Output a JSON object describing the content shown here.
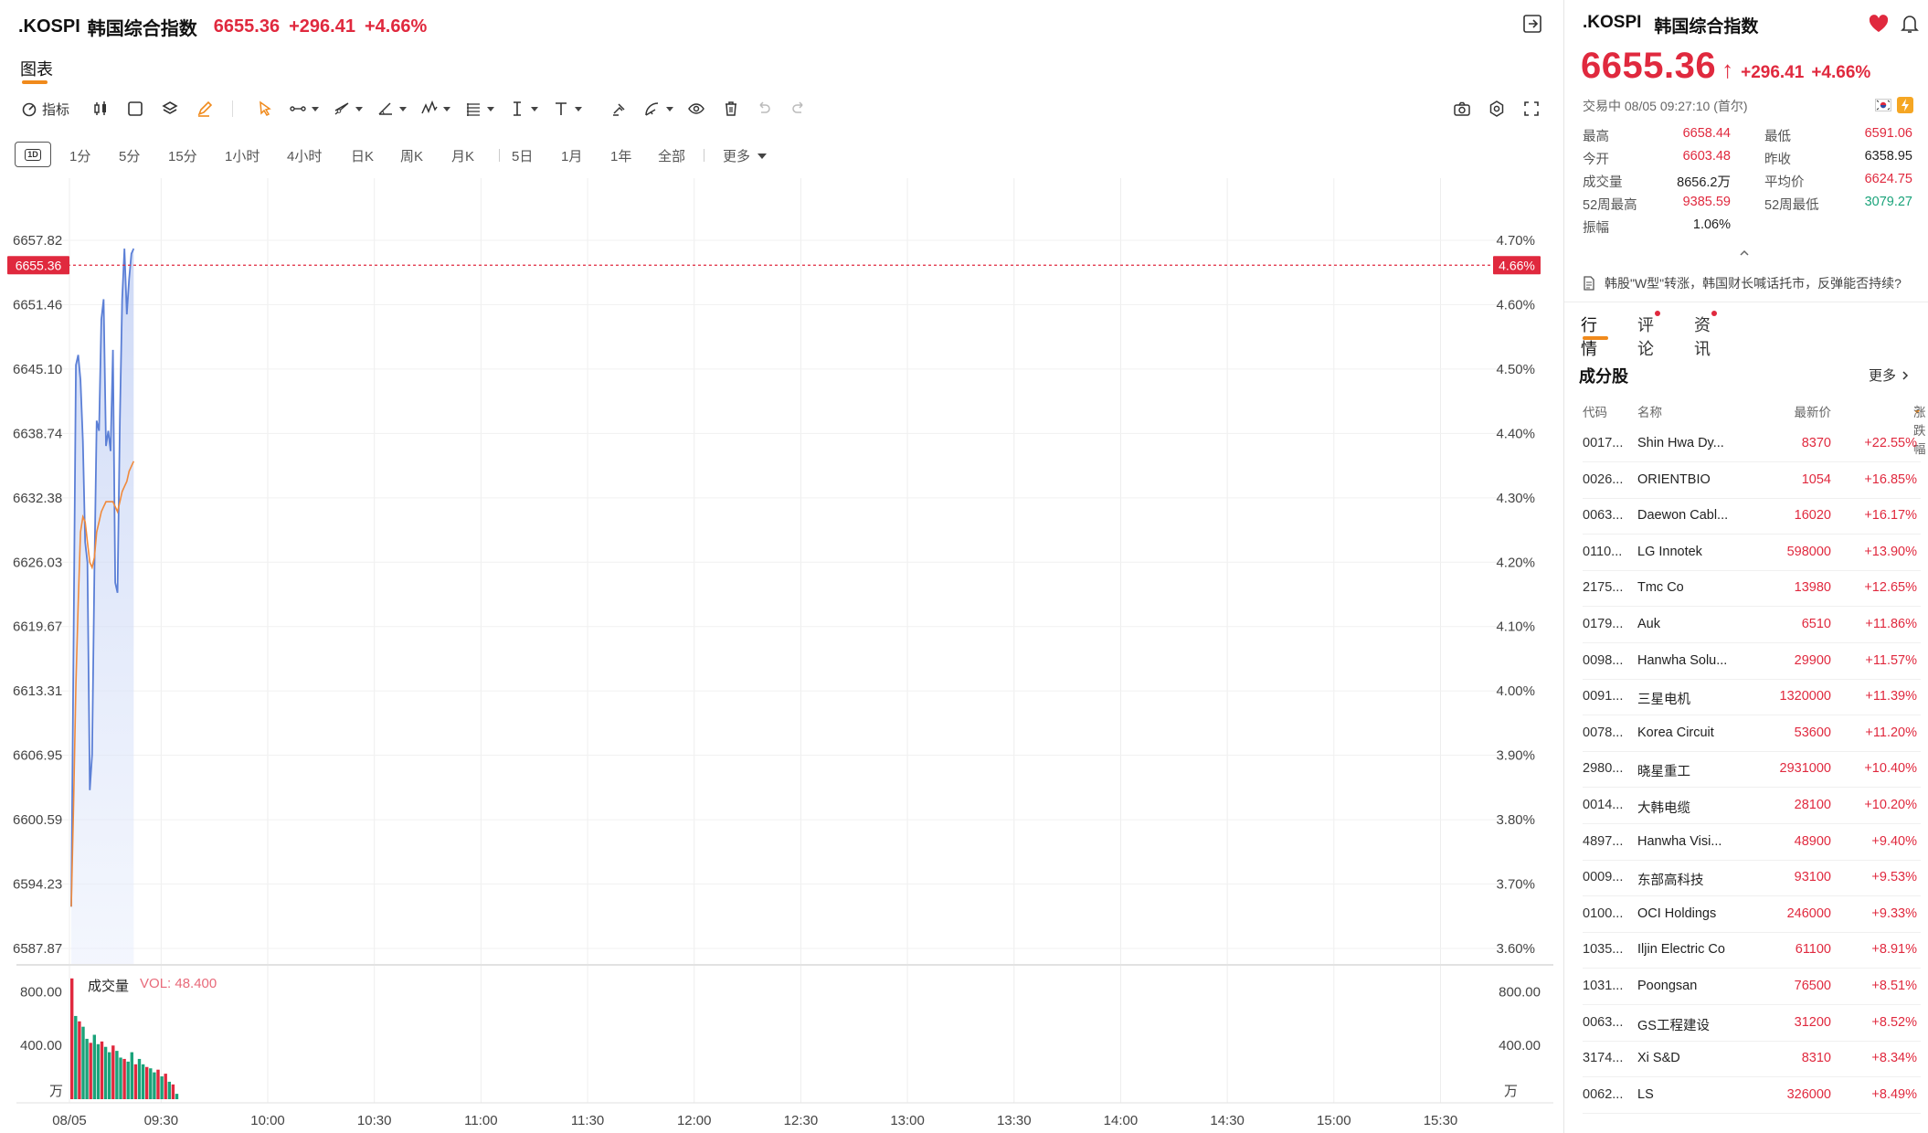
{
  "header": {
    "symbol": ".KOSPI",
    "name": "韩国综合指数",
    "price": "6655.36",
    "change": "+296.41",
    "change_pct": "+4.66%"
  },
  "tabs": {
    "chart": "图表"
  },
  "toolbar": {
    "indicators_label": "指标",
    "icons": [
      "indicator-icon",
      "candlestick-icon",
      "rectangle-icon",
      "layers-icon",
      "pencil-icon",
      "cursor-icon",
      "line-tool-icon",
      "ray-tool-icon",
      "angle-tool-icon",
      "wave-tool-icon",
      "fib-tool-icon",
      "text-cursor-icon",
      "text-tool-icon",
      "magnet-icon",
      "measure-icon",
      "eye-icon",
      "trash-icon",
      "undo-icon",
      "redo-icon",
      "camera-icon",
      "settings-icon",
      "fullscreen-icon"
    ]
  },
  "periods": {
    "box_label": "1D",
    "items": [
      "1分",
      "5分",
      "15分",
      "1小时",
      "4小时",
      "日K",
      "周K",
      "月K",
      "5日",
      "1月",
      "1年",
      "全部"
    ],
    "more_label": "更多"
  },
  "chart": {
    "left_ticks": [
      "6657.82",
      "6651.46",
      "6645.10",
      "6638.74",
      "6632.38",
      "6626.03",
      "6619.67",
      "6613.31",
      "6606.95",
      "6600.59",
      "6594.23",
      "6587.87"
    ],
    "right_ticks": [
      "4.70%",
      "4.60%",
      "4.50%",
      "4.40%",
      "4.30%",
      "4.20%",
      "4.10%",
      "4.00%",
      "3.90%",
      "3.80%",
      "3.70%",
      "3.60%"
    ],
    "current_left": "6655.36",
    "current_right": "4.66%",
    "time_labels": [
      "08/05",
      "09:30",
      "10:00",
      "10:30",
      "11:00",
      "11:30",
      "12:00",
      "12:30",
      "13:00",
      "13:30",
      "14:00",
      "14:30",
      "15:00",
      "15:30"
    ],
    "volume_title": "成交量",
    "volume_value": "VOL: 48.400",
    "vol_ticks": [
      "800.00",
      "400.00"
    ],
    "vol_unit": "万",
    "colors": {
      "price_line": "#5b7fd6",
      "avg_line": "#f08a3c",
      "up": "#e0293e",
      "down": "#1aa37a"
    }
  },
  "chart_data": {
    "type": "line",
    "title": "",
    "xlabel": "",
    "ylabel": "",
    "ylim": [
      6587.87,
      6657.82
    ],
    "x": [
      "09:00",
      "09:01",
      "09:02",
      "09:03",
      "09:04",
      "09:05",
      "09:06",
      "09:07",
      "09:08",
      "09:09",
      "09:10",
      "09:11",
      "09:12",
      "09:13",
      "09:14",
      "09:15",
      "09:16",
      "09:17",
      "09:18",
      "09:19",
      "09:20",
      "09:21",
      "09:22",
      "09:23",
      "09:24",
      "09:25",
      "09:26",
      "09:27"
    ],
    "series": [
      {
        "values": [
          6592.0,
          6618.0,
          6645.5,
          6646.5,
          6644.0,
          6638.0,
          6628.0,
          6626.0,
          6603.5,
          6607.0,
          6625.0,
          6640.0,
          6639.0,
          6650.0,
          6652.0,
          6637.5,
          6639.0,
          6637.0,
          6647.0,
          6624.0,
          6623.0,
          6640.0,
          6652.0,
          6657.0,
          6650.5,
          6654.0,
          6656.5,
          6657.0
        ]
      },
      {
        "values": [
          6592.0,
          6602.0,
          6614.0,
          6622.0,
          6629.0,
          6630.5,
          6630.0,
          6628.0,
          6626.0,
          6625.5,
          6626.5,
          6629.0,
          6630.0,
          6631.0,
          6631.5,
          6632.0,
          6632.0,
          6632.0,
          6632.0,
          6631.5,
          6631.0,
          6632.0,
          6633.0,
          6633.5,
          6634.0,
          6635.0,
          6635.5,
          6636.0
        ]
      }
    ],
    "volume": [
      900,
      620,
      580,
      540,
      450,
      420,
      480,
      410,
      430,
      390,
      350,
      400,
      360,
      310,
      300,
      280,
      350,
      260,
      300,
      260,
      240,
      230,
      200,
      220,
      170,
      190,
      130,
      110,
      40
    ],
    "volume_up": [
      true,
      false,
      true,
      false,
      false,
      true,
      false,
      false,
      true,
      false,
      false,
      true,
      false,
      false,
      true,
      false,
      false,
      true,
      false,
      false,
      true,
      false,
      false,
      true,
      false,
      true,
      false,
      true,
      false
    ],
    "volume_ylim": [
      0,
      1000
    ]
  },
  "side": {
    "symbol": ".KOSPI",
    "name": "韩国综合指数",
    "price": "6655.36",
    "arrow": "↑",
    "change": "+296.41",
    "change_pct": "+4.66%",
    "status": "交易中 08/05 09:27:10 (首尔)",
    "stats": [
      {
        "label": "最高",
        "value": "6658.44",
        "tone": "red"
      },
      {
        "label": "最低",
        "value": "6591.06",
        "tone": "red"
      },
      {
        "label": "今开",
        "value": "6603.48",
        "tone": "red"
      },
      {
        "label": "昨收",
        "value": "6358.95",
        "tone": "dark"
      },
      {
        "label": "成交量",
        "value": "8656.2万",
        "tone": "dark"
      },
      {
        "label": "平均价",
        "value": "6624.75",
        "tone": "red"
      },
      {
        "label": "52周最高",
        "value": "9385.59",
        "tone": "red"
      },
      {
        "label": "52周最低",
        "value": "3079.27",
        "tone": "green"
      },
      {
        "label": "振幅",
        "value": "1.06%",
        "tone": "dark"
      }
    ],
    "news": "韩股\"W型\"转涨，韩国财长喊话托市，反弹能否持续?",
    "tabs": [
      "行情",
      "评论",
      "资讯"
    ],
    "components_title": "成分股",
    "more_label": "更多",
    "headers": {
      "code": "代码",
      "name": "名称",
      "price": "最新价",
      "change": "涨跌幅"
    },
    "rows": [
      {
        "code": "0017...",
        "name": "Shin Hwa Dy...",
        "price": "8370",
        "change": "+22.55%"
      },
      {
        "code": "0026...",
        "name": "ORIENTBIO",
        "price": "1054",
        "change": "+16.85%"
      },
      {
        "code": "0063...",
        "name": "Daewon Cabl...",
        "price": "16020",
        "change": "+16.17%"
      },
      {
        "code": "0110...",
        "name": "LG Innotek",
        "price": "598000",
        "change": "+13.90%"
      },
      {
        "code": "2175...",
        "name": "Tmc Co",
        "price": "13980",
        "change": "+12.65%"
      },
      {
        "code": "0179...",
        "name": "Auk",
        "price": "6510",
        "change": "+11.86%"
      },
      {
        "code": "0098...",
        "name": "Hanwha Solu...",
        "price": "29900",
        "change": "+11.57%"
      },
      {
        "code": "0091...",
        "name": "三星电机",
        "price": "1320000",
        "change": "+11.39%"
      },
      {
        "code": "0078...",
        "name": "Korea Circuit",
        "price": "53600",
        "change": "+11.20%"
      },
      {
        "code": "2980...",
        "name": "晓星重工",
        "price": "2931000",
        "change": "+10.40%"
      },
      {
        "code": "0014...",
        "name": "大韩电缆",
        "price": "28100",
        "change": "+10.20%"
      },
      {
        "code": "4897...",
        "name": "Hanwha Visi...",
        "price": "48900",
        "change": "+9.40%"
      },
      {
        "code": "0009...",
        "name": "东部高科技",
        "price": "93100",
        "change": "+9.53%"
      },
      {
        "code": "0100...",
        "name": "OCI Holdings",
        "price": "246000",
        "change": "+9.33%"
      },
      {
        "code": "1035...",
        "name": "Iljin Electric Co",
        "price": "61100",
        "change": "+8.91%"
      },
      {
        "code": "1031...",
        "name": "Poongsan",
        "price": "76500",
        "change": "+8.51%"
      },
      {
        "code": "0063...",
        "name": "GS工程建设",
        "price": "31200",
        "change": "+8.52%"
      },
      {
        "code": "3174...",
        "name": "Xi S&D",
        "price": "8310",
        "change": "+8.34%"
      },
      {
        "code": "0062...",
        "name": "LS",
        "price": "326000",
        "change": "+8.49%"
      }
    ]
  }
}
